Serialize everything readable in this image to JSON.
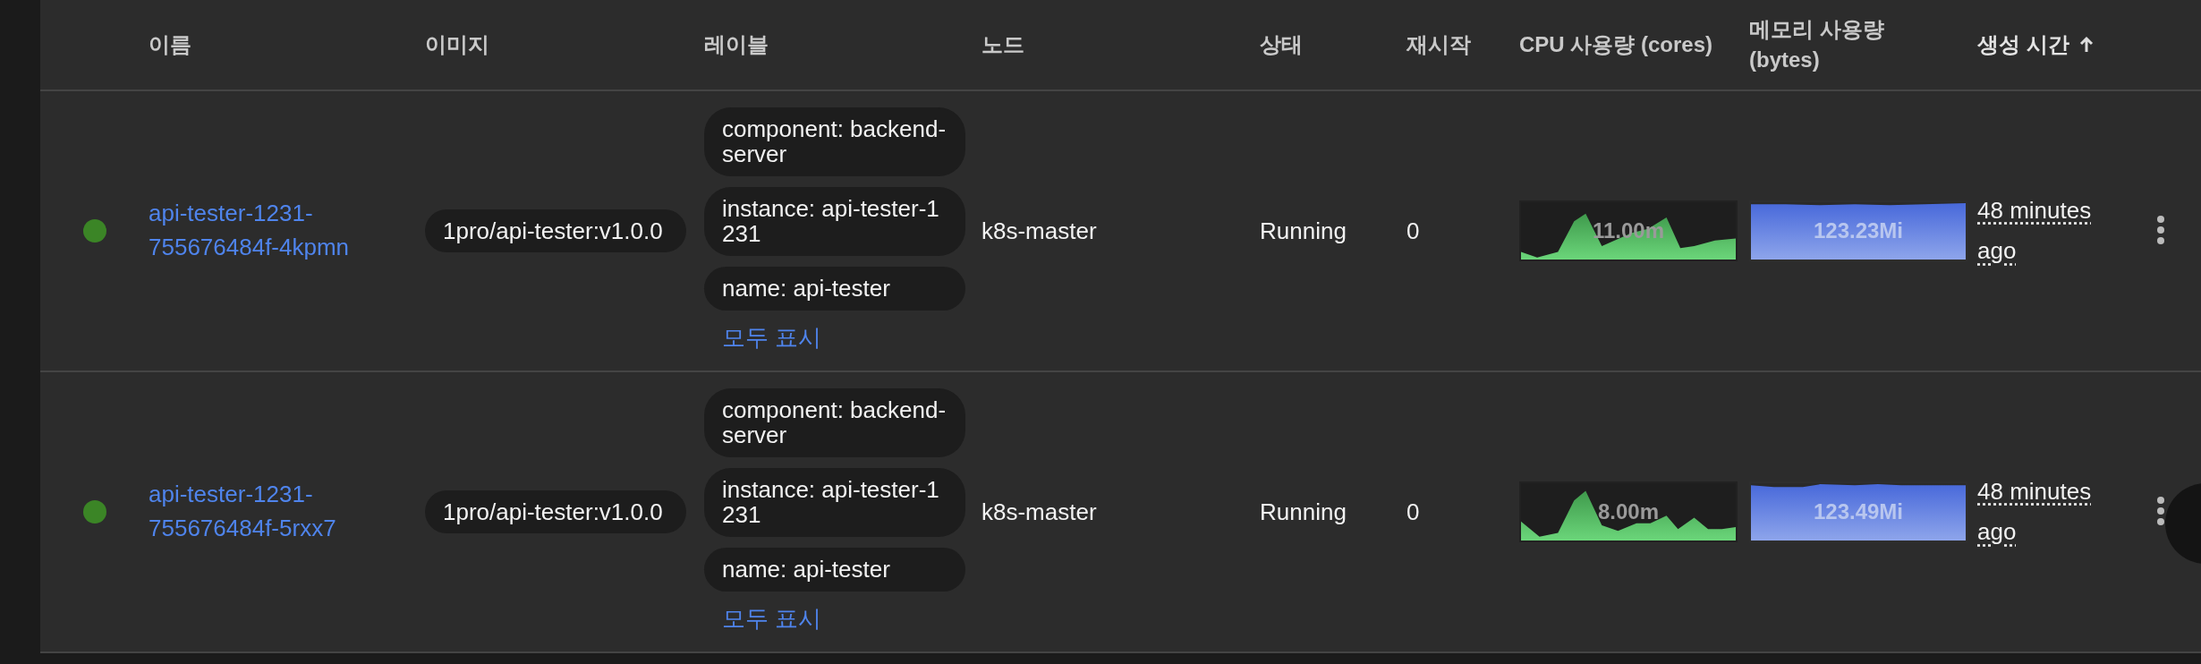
{
  "columns": [
    {
      "label": "이름",
      "sorted": false
    },
    {
      "label": "이미지",
      "sorted": false
    },
    {
      "label": "레이블",
      "sorted": false
    },
    {
      "label": "노드",
      "sorted": false
    },
    {
      "label": "상태",
      "sorted": false
    },
    {
      "label": "재시작",
      "sorted": false
    },
    {
      "label": "CPU 사용량 (cores)",
      "sorted": false
    },
    {
      "label": "메모리 사용량 (bytes)",
      "sorted": false
    },
    {
      "label": "생성 시간",
      "sorted": true
    }
  ],
  "rows": [
    {
      "color": "#3b8526",
      "name": "api-tester-1231-755676484f-4kpmn",
      "image": "1pro/api-tester:v1.0.0",
      "labels": [
        "component: backend-server",
        "instance: api-tester-1231",
        "name: api-tester"
      ],
      "show_all": "모두 표시",
      "node": "k8s-master",
      "status": "Running",
      "restarts": "0",
      "cpu": "11.00m",
      "memory": "123.23Mi",
      "created": "48 minutes ago"
    },
    {
      "color": "#3b8526",
      "name": "api-tester-1231-755676484f-5rxx7",
      "image": "1pro/api-tester:v1.0.0",
      "labels": [
        "component: backend-server",
        "instance: api-tester-1231",
        "name: api-tester"
      ],
      "show_all": "모두 표시",
      "node": "k8s-master",
      "status": "Running",
      "restarts": "0",
      "cpu": "8.00m",
      "memory": "123.49Mi",
      "created": "48 minutes ago"
    }
  ]
}
